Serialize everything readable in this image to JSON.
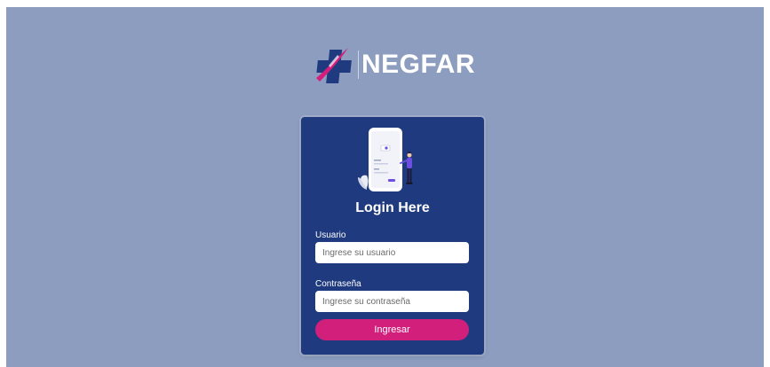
{
  "brand": {
    "name": "NEGFAR"
  },
  "login": {
    "title": "Login Here",
    "username_label": "Usuario",
    "username_placeholder": "Ingrese su usuario",
    "username_value": "",
    "password_label": "Contraseña",
    "password_placeholder": "Ingrese su contraseña",
    "password_value": "",
    "submit_label": "Ingresar"
  },
  "colors": {
    "background": "#8d9dbf",
    "card": "#1f3a7f",
    "button": "#d31f7c",
    "logo_blue": "#1f3a7f",
    "logo_magenta": "#d31f7c"
  },
  "icons": {
    "logo": "negfar-cross-logo-icon",
    "illustration": "phone-login-illustration"
  }
}
